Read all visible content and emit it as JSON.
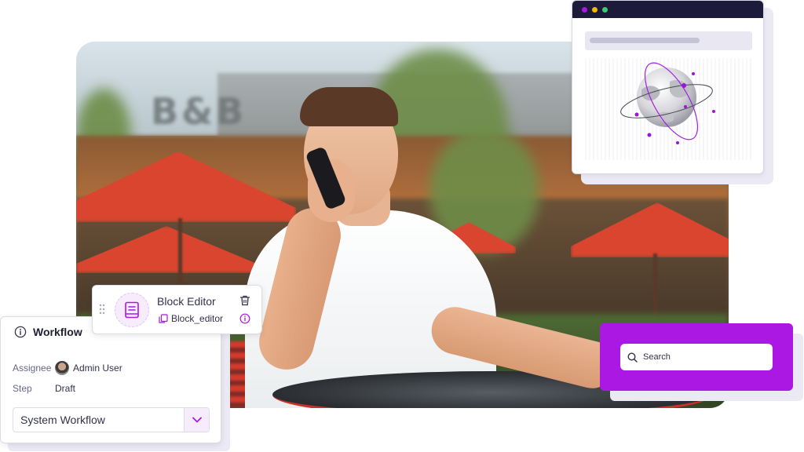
{
  "workflow": {
    "title": "Workflow",
    "assignee_label": "Assignee",
    "assignee_value": "Admin User",
    "step_label": "Step",
    "step_value": "Draft",
    "select_value": "System Workflow"
  },
  "block_editor": {
    "title": "Block Editor",
    "component_name": "Block_editor"
  },
  "search": {
    "placeholder": "Search"
  },
  "photo": {
    "sign_text": "B&B"
  },
  "colors": {
    "accent": "#ab18e3",
    "accent_light": "#f6ecfc",
    "dark_bar": "#1c1c3a",
    "window_dot_1": "#ab18e3",
    "window_dot_2": "#f5b800",
    "window_dot_3": "#3dcb6d"
  },
  "icons": [
    "info-icon",
    "chevron-down-icon",
    "drag-handle-icon",
    "book-icon",
    "copy-icon",
    "trash-icon",
    "search-icon",
    "globe-icon"
  ]
}
